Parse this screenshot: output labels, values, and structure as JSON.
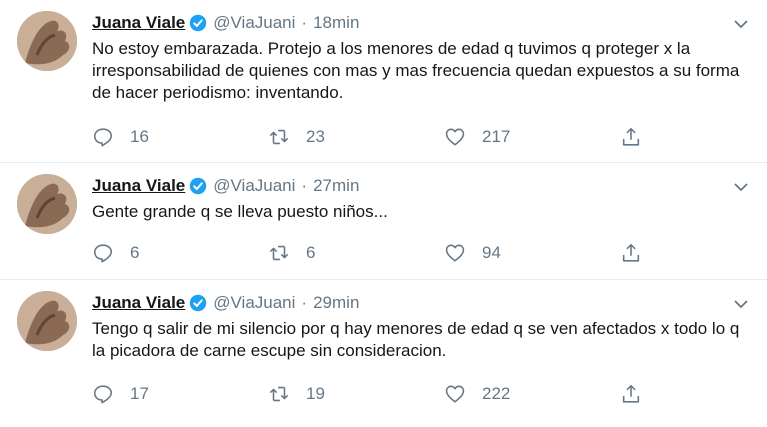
{
  "tweets": [
    {
      "name": "Juana Viale",
      "handle": "@ViaJuani",
      "separator": "·",
      "time": "18min",
      "text": "No estoy embarazada. Protejo a los menores de edad q tuvimos q proteger x la irresponsabilidad de quienes con mas y mas frecuencia quedan expuestos a su forma de hacer periodismo: inventando.",
      "replies": "16",
      "retweets": "23",
      "likes": "217"
    },
    {
      "name": "Juana Viale",
      "handle": "@ViaJuani",
      "separator": "·",
      "time": "27min",
      "text": "Gente grande q se lleva puesto niños...",
      "replies": "6",
      "retweets": "6",
      "likes": "94"
    },
    {
      "name": "Juana Viale",
      "handle": "@ViaJuani",
      "separator": "·",
      "time": "29min",
      "text": "Tengo q salir de mi silencio por q hay menores de edad q se ven afectados x todo lo q la picadora de carne escupe sin consideracion.",
      "replies": "17",
      "retweets": "19",
      "likes": "222"
    }
  ],
  "icons": {
    "verified": "verified-badge-icon",
    "menu": "chevron-down-icon",
    "reply": "reply-icon",
    "retweet": "retweet-icon",
    "like": "heart-icon",
    "share": "share-icon"
  },
  "colors": {
    "verified": "#1da1f2",
    "secondary_text": "#657786",
    "divider": "#e6ecf0"
  }
}
